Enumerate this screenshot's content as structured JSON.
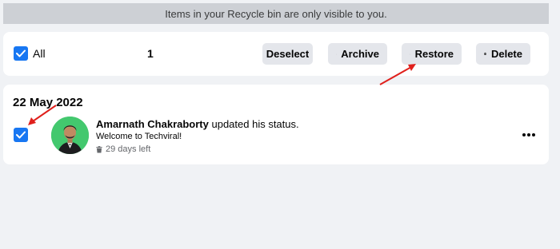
{
  "banner": {
    "text": "Items in your Recycle bin are only visible to you."
  },
  "toolbar": {
    "select_all_label": "All",
    "selected_count": "1",
    "deselect_label": "Deselect",
    "archive_label": "Archive",
    "restore_label": "Restore",
    "delete_label": "Delete"
  },
  "post": {
    "date": "22 May 2022",
    "author": "Amarnath Chakraborty",
    "action": " updated his status.",
    "content": "Welcome to Techviral!",
    "expiry": "29 days left",
    "selected": true
  },
  "colors": {
    "accent": "#1877f2",
    "annotation_arrow": "#e0201c",
    "avatar_bg": "#43c86e"
  },
  "icons": {
    "checkbox": "checkmark-icon",
    "archive": "archive-box-icon",
    "restore": "restore-undo-icon",
    "delete": "trash-icon",
    "expiry": "trash-icon",
    "more": "more-horizontal-icon"
  }
}
